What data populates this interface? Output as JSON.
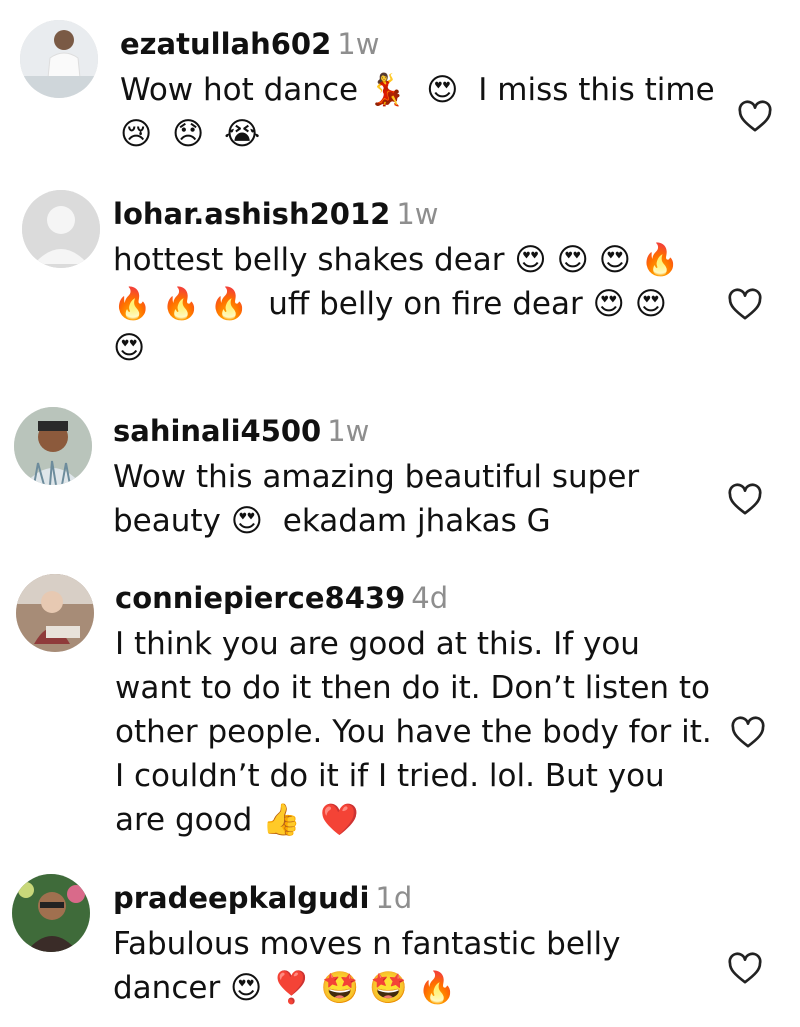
{
  "comments": [
    {
      "username": "ezatullah602",
      "time": "1w",
      "text_lines": [
        "Wow hot dance 💃  😍  I miss this time",
        "😢  😞  😭"
      ],
      "avatar": "avatar-man-white-outfit"
    },
    {
      "username": "lohar.ashish2012",
      "time": "1w",
      "text_lines": [
        "hottest belly shakes dear 😍 😍 😍 🔥",
        "🔥 🔥 🔥  uff belly on fire dear 😍 😍",
        "😍"
      ],
      "avatar": "avatar-default-placeholder"
    },
    {
      "username": "sahinali4500",
      "time": "1w",
      "text_lines": [
        "Wow this amazing beautiful super",
        "beauty 😍  ekadam jhakas G"
      ],
      "avatar": "avatar-man-portrait"
    },
    {
      "username": "conniepierce8439",
      "time": "4d",
      "text_lines": [
        "I think you are good at this. If you",
        "want to do it then do it. Don’t listen to",
        "other people. You have the body for it.",
        "I couldn’t do it if I tried. lol. But you",
        "are good 👍  ❤️"
      ],
      "avatar": "avatar-woman-seated"
    },
    {
      "username": "pradeepkalgudi",
      "time": "1d",
      "text_lines": [
        "Fabulous moves n fantastic belly",
        "dancer 😍 ❣️ 🤩 🤩 🔥"
      ],
      "avatar": "avatar-man-glasses"
    }
  ],
  "colors": {
    "username": "#111111",
    "time": "#8e8e8e",
    "heart_outline": "#222222"
  },
  "icons": {
    "like": "heart-outline-icon"
  }
}
